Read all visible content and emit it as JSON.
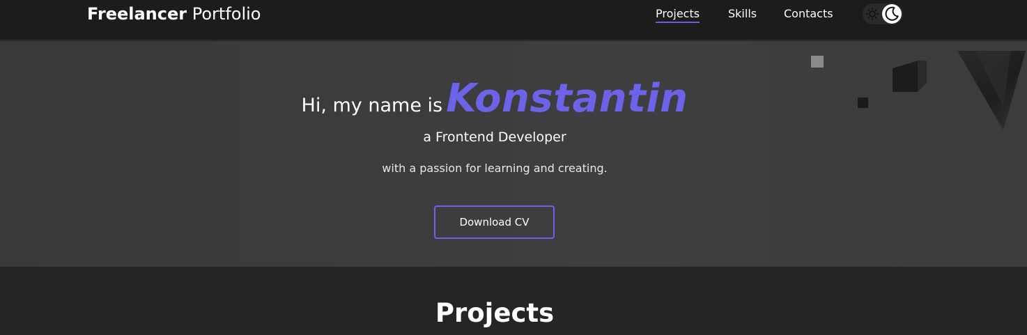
{
  "header": {
    "logo_bold": "Freelancer",
    "logo_light": "Portfolio",
    "nav": [
      {
        "label": "Projects",
        "active": true
      },
      {
        "label": "Skills",
        "active": false
      },
      {
        "label": "Contacts",
        "active": false
      }
    ],
    "theme_toggle": {
      "left_icon": "sun-icon",
      "right_icon": "moon-icon",
      "selected": "dark"
    }
  },
  "hero": {
    "greeting": "Hi, my name is",
    "name": "Konstantin",
    "role": "a Frontend Developer",
    "tagline": "with a passion for learning and creating.",
    "cta_label": "Download CV"
  },
  "projects": {
    "heading": "Projects"
  },
  "colors": {
    "accent": "#6c63e8",
    "header_bg": "#1c1c1c",
    "hero_bg": "#3d3c3d",
    "page_bg": "#252525"
  }
}
